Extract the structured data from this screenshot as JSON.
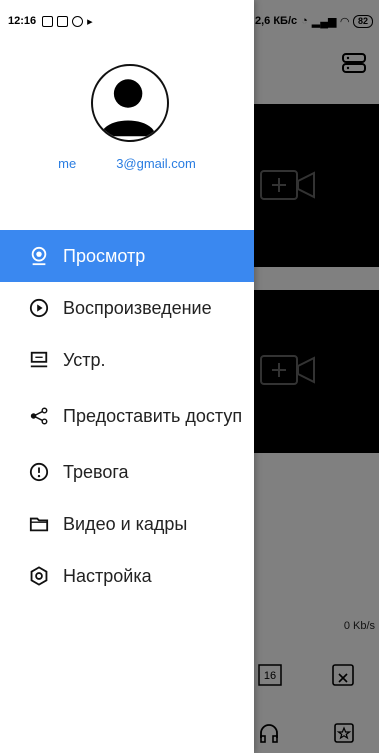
{
  "status_bar": {
    "time": "12:16",
    "network_speed": "2,6 КБ/с",
    "battery": "82"
  },
  "drawer": {
    "email_part1": "me",
    "email_part2": "3@gmail.com",
    "menu": [
      {
        "label": "Просмотр",
        "icon": "camera-icon",
        "active": true
      },
      {
        "label": "Воспроизведение",
        "icon": "play-circle-icon",
        "active": false
      },
      {
        "label": "Устр.",
        "icon": "device-icon",
        "active": false
      },
      {
        "label": "Предоставить доступ",
        "icon": "share-icon",
        "active": false
      },
      {
        "label": "Тревога",
        "icon": "alarm-icon",
        "active": false
      },
      {
        "label": "Видео и кадры",
        "icon": "folder-icon",
        "active": false
      },
      {
        "label": "Настройка",
        "icon": "settings-icon",
        "active": false
      }
    ],
    "accent_color": "#3a88f0"
  },
  "background_app": {
    "speed_label": "0 Kb/s",
    "grid_label": "16"
  }
}
